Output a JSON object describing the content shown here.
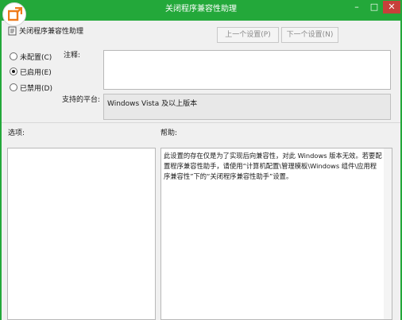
{
  "window": {
    "title": "关闭程序兼容性助理",
    "buttons": {
      "minimize": "–",
      "maximize": "□",
      "close": "✕"
    },
    "accent_color": "#23a83a"
  },
  "header": {
    "policy_name": "关闭程序兼容性助理",
    "prev_button": "上一个设置(P)",
    "next_button": "下一个设置(N)"
  },
  "state": {
    "options": [
      {
        "label": "未配置(C)",
        "checked": false
      },
      {
        "label": "已启用(E)",
        "checked": true
      },
      {
        "label": "已禁用(D)",
        "checked": false
      }
    ]
  },
  "comment": {
    "label": "注释:",
    "value": ""
  },
  "platform": {
    "label": "支持的平台:",
    "value": "Windows Vista 及以上版本"
  },
  "options_section": {
    "label": "选项:"
  },
  "help_section": {
    "label": "帮助:",
    "text": "此设置的存在仅是为了实现后向兼容性，对此 Windows 版本无效。若要配置程序兼容性助手，请使用“计算机配置\\管理模板\\Windows 组件\\应用程序兼容性”下的“关闭程序兼容性助手”设置。"
  }
}
